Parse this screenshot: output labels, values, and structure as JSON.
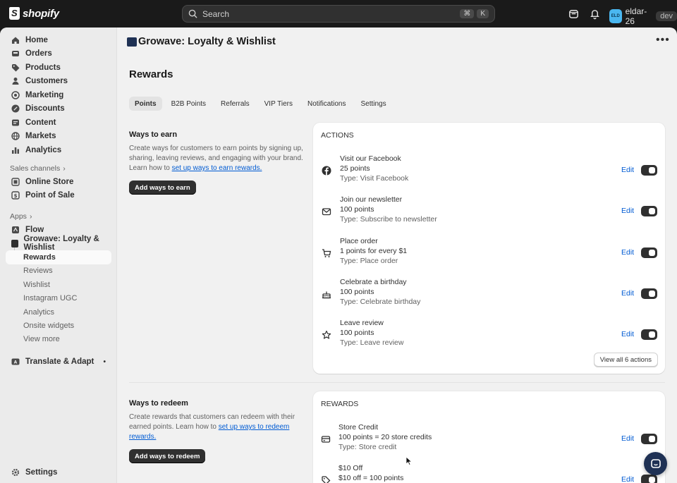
{
  "topbar": {
    "brand": "shopify",
    "search_placeholder": "Search",
    "shortcut_keys": [
      "⌘",
      "K"
    ],
    "user": {
      "initials": "ELD",
      "name": "eldar-26",
      "tag": "dev"
    }
  },
  "sidebar": {
    "items": [
      {
        "label": "Home",
        "icon": "home-icon"
      },
      {
        "label": "Orders",
        "icon": "inbox-icon"
      },
      {
        "label": "Products",
        "icon": "tag-icon"
      },
      {
        "label": "Customers",
        "icon": "person-icon"
      },
      {
        "label": "Marketing",
        "icon": "target-icon"
      },
      {
        "label": "Discounts",
        "icon": "discount-icon"
      },
      {
        "label": "Content",
        "icon": "content-icon"
      },
      {
        "label": "Markets",
        "icon": "globe-icon"
      },
      {
        "label": "Analytics",
        "icon": "bar-chart-icon"
      }
    ],
    "sales_channels_label": "Sales channels",
    "channels": [
      {
        "label": "Online Store",
        "icon": "store-icon"
      },
      {
        "label": "Point of Sale",
        "icon": "pos-icon"
      }
    ],
    "apps_label": "Apps",
    "apps": [
      {
        "label": "Flow",
        "icon": "flow-icon"
      },
      {
        "label": "Growave: Loyalty & Wishlist",
        "icon": "growave-app-icon"
      }
    ],
    "app_subitems": [
      "Rewards",
      "Reviews",
      "Wishlist",
      "Instagram UGC",
      "Analytics",
      "Onsite widgets",
      "View more"
    ],
    "extra_app": {
      "label": "Translate & Adapt",
      "icon": "translate-icon"
    },
    "settings_label": "Settings"
  },
  "main": {
    "app_title": "Growave: Loyalty & Wishlist",
    "page_title": "Rewards",
    "tabs": [
      "Points",
      "B2B Points",
      "Referrals",
      "VIP Tiers",
      "Notifications",
      "Settings"
    ],
    "earn": {
      "title": "Ways to earn",
      "desc_pre": "Create ways for customers to earn points by signing up, sharing, leaving reviews, and engaging with your brand. Learn how to ",
      "desc_link": "set up ways to earn rewards.",
      "button": "Add ways to earn"
    },
    "actions_card": {
      "heading": "ACTIONS",
      "rows": [
        {
          "icon": "facebook-icon",
          "title": "Visit our Facebook",
          "points": "25 points",
          "type": "Type: Visit Facebook"
        },
        {
          "icon": "envelope-icon",
          "title": "Join our newsletter",
          "points": "100 points",
          "type": "Type: Subscribe to newsletter"
        },
        {
          "icon": "cart-icon",
          "title": "Place order",
          "points": "1 points for every $1",
          "type": "Type: Place order"
        },
        {
          "icon": "cake-icon",
          "title": "Celebrate a birthday",
          "points": "100 points",
          "type": "Type: Celebrate birthday"
        },
        {
          "icon": "star-icon",
          "title": "Leave review",
          "points": "100 points",
          "type": "Type: Leave review"
        }
      ],
      "edit_label": "Edit",
      "view_all": "View all 6 actions"
    },
    "redeem": {
      "title": "Ways to redeem",
      "desc_pre": "Create rewards that customers can redeem with their earned points. Learn how to ",
      "desc_link": "set up ways to redeem rewards.",
      "button": "Add ways to redeem"
    },
    "rewards_card": {
      "heading": "REWARDS",
      "rows": [
        {
          "icon": "credit-card-icon",
          "title": "Store Credit",
          "points": "100 points = 20 store credits",
          "type": "Type: Store credit"
        },
        {
          "icon": "discount-tag-icon",
          "title": "$10 Off",
          "points": "$10 off = 100 points",
          "type": ""
        }
      ],
      "edit_label": "Edit"
    }
  }
}
